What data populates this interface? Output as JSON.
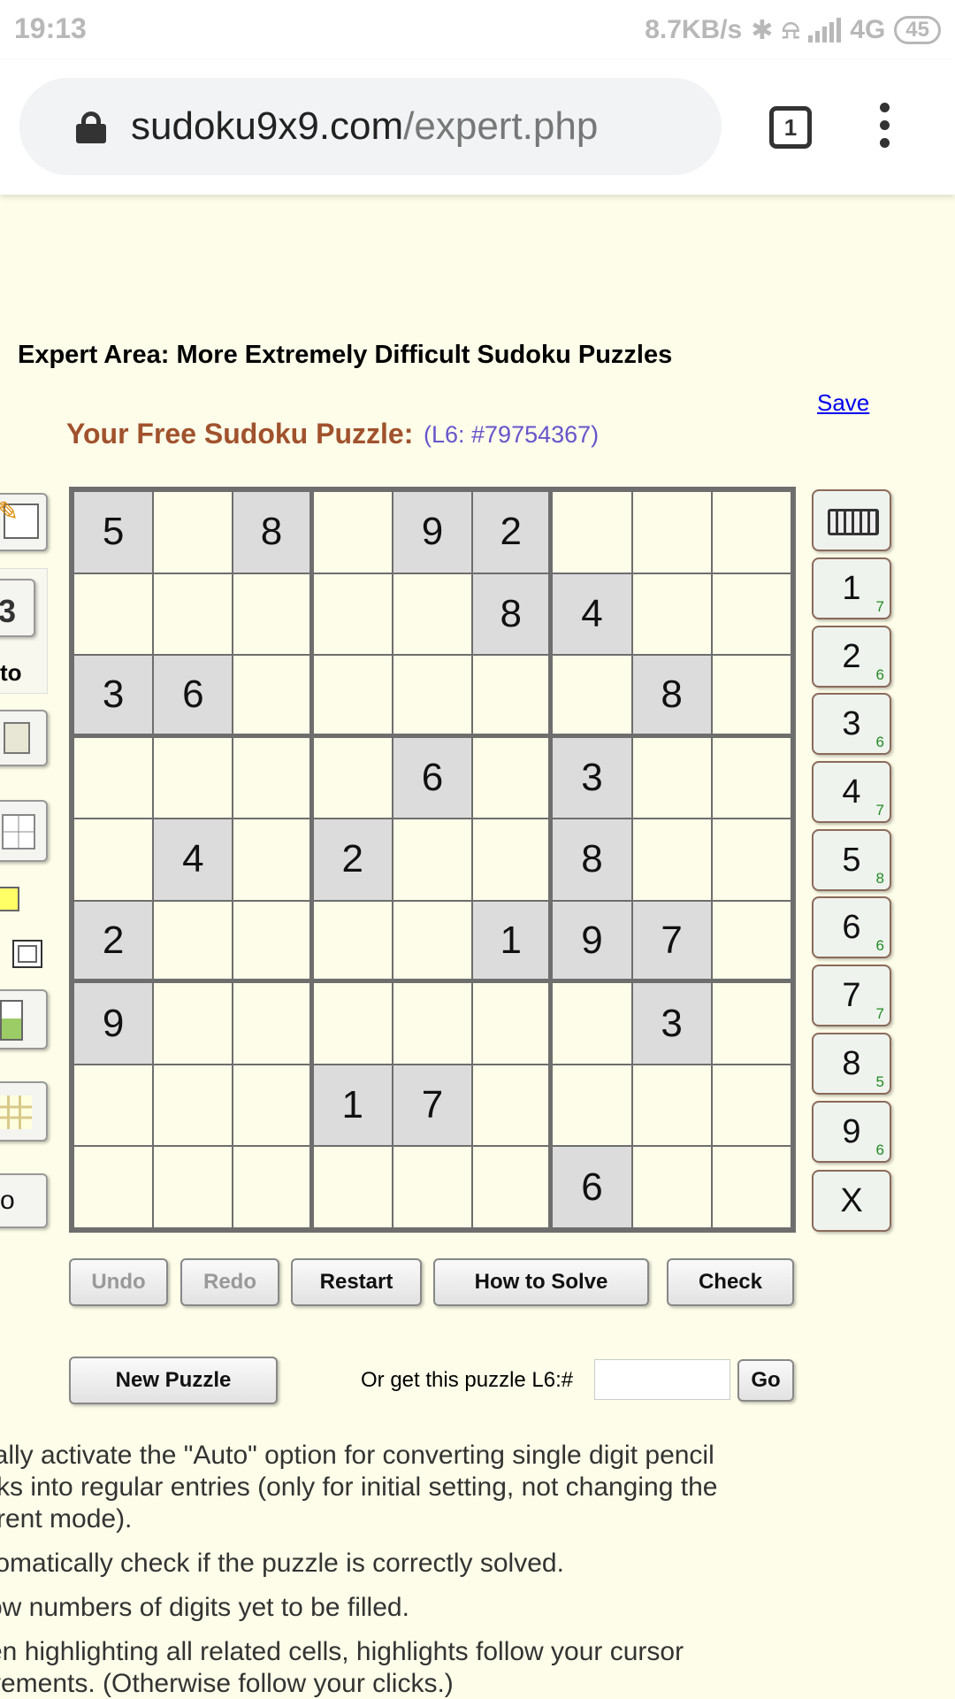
{
  "status_bar": {
    "time": "19:13",
    "net_speed": "8.7KB/s",
    "network": "4G",
    "battery": "45",
    "icons": [
      "bluetooth-icon",
      "mute-bell-icon",
      "signal-icon"
    ]
  },
  "browser": {
    "url_domain": "sudoku9x9.com",
    "url_path": "/expert.php",
    "tab_count": "1"
  },
  "page": {
    "heading": "Expert Area: More Extremely Difficult Sudoku Puzzles",
    "save_link": "Save",
    "puzzle_title": "Your Free Sudoku Puzzle:",
    "puzzle_id": "(L6: #79754367)"
  },
  "tools": {
    "auto_label": "to",
    "pencil_digit": "3"
  },
  "grid": [
    [
      "5",
      "",
      "8",
      "",
      "9",
      "2",
      "",
      "",
      ""
    ],
    [
      "",
      "",
      "",
      "",
      "",
      "8",
      "4",
      "",
      ""
    ],
    [
      "3",
      "6",
      "",
      "",
      "",
      "",
      "",
      "8",
      ""
    ],
    [
      "",
      "",
      "",
      "",
      "6",
      "",
      "3",
      "",
      ""
    ],
    [
      "",
      "4",
      "",
      "2",
      "",
      "",
      "8",
      "",
      ""
    ],
    [
      "2",
      "",
      "",
      "",
      "",
      "1",
      "9",
      "7",
      ""
    ],
    [
      "9",
      "",
      "",
      "",
      "",
      "",
      "",
      "3",
      ""
    ],
    [
      "",
      "",
      "",
      "1",
      "7",
      "",
      "",
      "",
      ""
    ],
    [
      "",
      "",
      "",
      "",
      "",
      "",
      "6",
      "",
      ""
    ]
  ],
  "numpad": {
    "keyboard_icon": "keyboard-icon",
    "digits": [
      {
        "digit": "1",
        "remaining": "7"
      },
      {
        "digit": "2",
        "remaining": "6"
      },
      {
        "digit": "3",
        "remaining": "6"
      },
      {
        "digit": "4",
        "remaining": "7"
      },
      {
        "digit": "5",
        "remaining": "8"
      },
      {
        "digit": "6",
        "remaining": "6"
      },
      {
        "digit": "7",
        "remaining": "7"
      },
      {
        "digit": "8",
        "remaining": "5"
      },
      {
        "digit": "9",
        "remaining": "6"
      }
    ],
    "erase_label": "X"
  },
  "buttons": {
    "undo": "Undo",
    "redo": "Redo",
    "restart": "Restart",
    "how_to_solve": "How to Solve",
    "check": "Check",
    "new_puzzle": "New Puzzle",
    "get_puzzle_label": "Or get this puzzle L6:#",
    "go": "Go",
    "partial_bottom": "o"
  },
  "help_lines": [
    "ially activate the \"Auto\" option for converting single digit pencil",
    "rks into regular entries (only for initial setting, not changing the",
    "rrent mode).",
    "tomatically check if the puzzle is correctly solved.",
    "ow numbers of digits yet to be filled.",
    "en highlighting all related cells, highlights follow your cursor",
    "vements. (Otherwise follow your clicks.)"
  ]
}
